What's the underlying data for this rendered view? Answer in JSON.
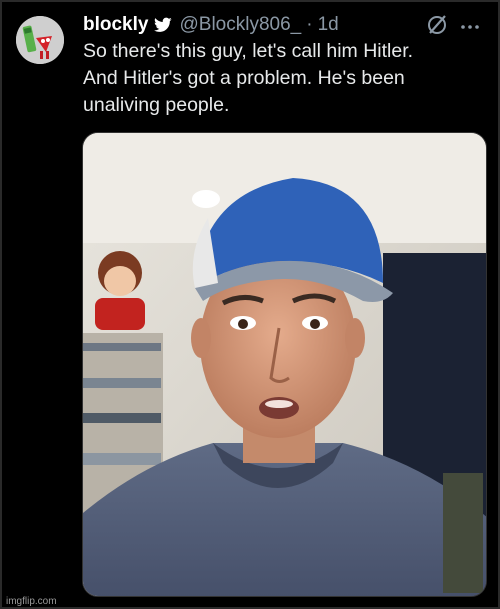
{
  "tweet": {
    "display_name": "blockly",
    "handle": "@Blockly806_",
    "separator": "·",
    "time": "1d",
    "text_lines": [
      "So there's this guy, let's call him Hitler.",
      "And Hitler's got a problem. He's been",
      "unaliving people."
    ]
  },
  "icons": {
    "verified": "twitter-bird-icon",
    "grok": "grok-icon",
    "more": "more-options-icon"
  },
  "colors": {
    "background": "#000000",
    "primary_text": "#e7e9ea",
    "secondary_text": "#8b98a5",
    "bird_blue": "#ffffff"
  },
  "watermark": "imgflip.com"
}
